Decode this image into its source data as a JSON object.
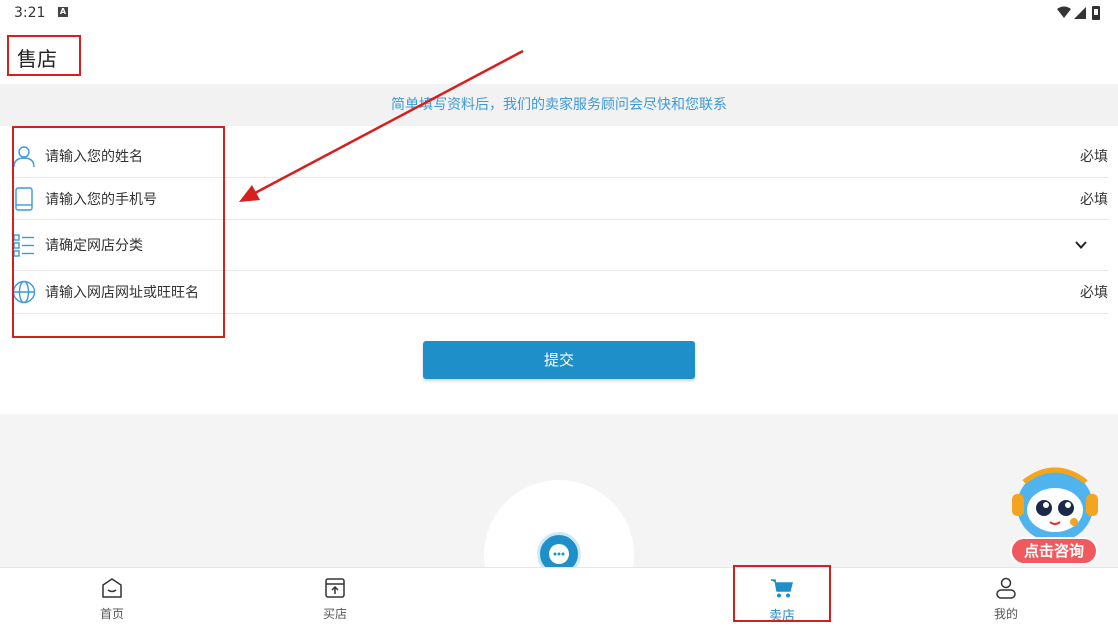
{
  "status_bar": {
    "time": "3:21",
    "notification_badge": "A"
  },
  "header": {
    "title": "售店"
  },
  "notice": "简单填写资料后，我们的卖家服务顾问会尽快和您联系",
  "form": {
    "rows": [
      {
        "label": "请输入您的姓名",
        "right": "必填",
        "icon": "user-icon"
      },
      {
        "label": "请输入您的手机号",
        "right": "必填",
        "icon": "phone-icon"
      },
      {
        "label": "请确定网店分类",
        "right": "",
        "icon": "list-icon"
      },
      {
        "label": "请输入网店网址或旺旺名",
        "right": "必填",
        "icon": "globe-icon"
      }
    ],
    "submit_label": "提交"
  },
  "assistant": {
    "caption": "点击咨询"
  },
  "tabbar": {
    "tabs": [
      {
        "label": "首页",
        "icon": "home-icon"
      },
      {
        "label": "买店",
        "icon": "store-upload-icon"
      },
      {
        "label": "卖店",
        "icon": "cart-icon",
        "active": true
      },
      {
        "label": "我的",
        "icon": "profile-icon"
      }
    ]
  },
  "colors": {
    "accent": "#1f8fca",
    "notice_text": "#3d9ad6",
    "annotation_red": "#d61f1f"
  }
}
